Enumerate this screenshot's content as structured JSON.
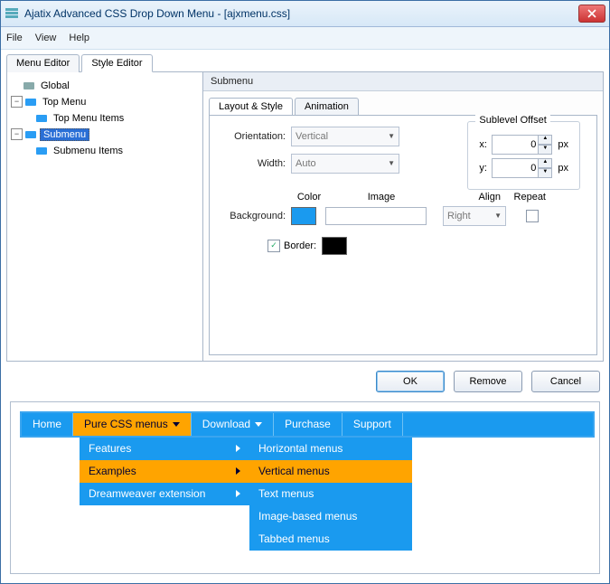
{
  "window": {
    "title": "Ajatix Advanced CSS Drop Down Menu - [ajxmenu.css]"
  },
  "menubar": [
    "File",
    "View",
    "Help"
  ],
  "tabs": {
    "menu_editor": "Menu Editor",
    "style_editor": "Style Editor"
  },
  "tree": {
    "global": "Global",
    "top_menu": "Top Menu",
    "top_items": "Top Menu Items",
    "submenu": "Submenu",
    "submenu_items": "Submenu Items"
  },
  "props": {
    "header": "Submenu",
    "tabs": {
      "layout": "Layout & Style",
      "animation": "Animation"
    },
    "orientation_label": "Orientation:",
    "orientation_value": "Vertical",
    "width_label": "Width:",
    "width_value": "Auto",
    "offset": {
      "legend": "Sublevel Offset",
      "x_label": "x:",
      "x_value": "0",
      "y_label": "y:",
      "y_value": "0",
      "unit": "px"
    },
    "hdr": {
      "color": "Color",
      "image": "Image",
      "align": "Align",
      "repeat": "Repeat"
    },
    "background_label": "Background:",
    "bg_color": "#1a9aef",
    "align_value": "Right",
    "border_label": "Border:",
    "border_color": "#000000"
  },
  "buttons": {
    "ok": "OK",
    "remove": "Remove",
    "cancel": "Cancel"
  },
  "nav": {
    "items": [
      "Home",
      "Pure CSS menus",
      "Download",
      "Purchase",
      "Support"
    ],
    "sub1": [
      "Features",
      "Examples",
      "Dreamweaver extension"
    ],
    "sub2": [
      "Horizontal menus",
      "Vertical menus",
      "Text menus",
      "Image-based menus",
      "Tabbed menus"
    ]
  }
}
